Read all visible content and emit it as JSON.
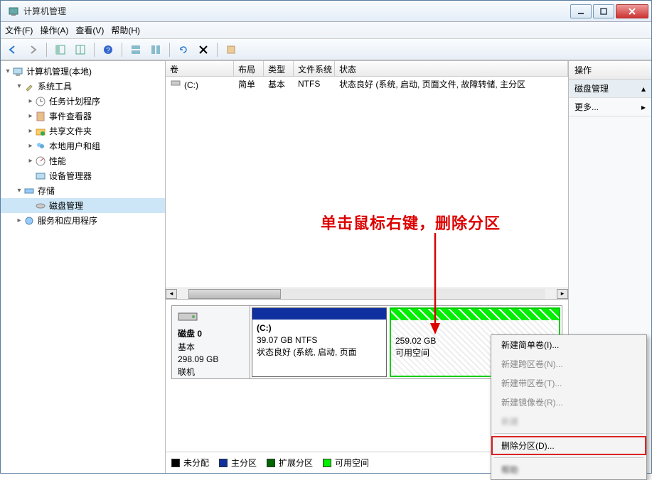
{
  "window": {
    "title": "计算机管理"
  },
  "menu": {
    "file": "文件(F)",
    "action": "操作(A)",
    "view": "查看(V)",
    "help": "帮助(H)"
  },
  "tree": {
    "root": "计算机管理(本地)",
    "system_tools": "系统工具",
    "task_scheduler": "任务计划程序",
    "event_viewer": "事件查看器",
    "shared_folders": "共享文件夹",
    "local_users": "本地用户和组",
    "performance": "性能",
    "device_manager": "设备管理器",
    "storage": "存储",
    "disk_management": "磁盘管理",
    "services_apps": "服务和应用程序"
  },
  "volume_table": {
    "headers": {
      "volume": "卷",
      "layout": "布局",
      "type": "类型",
      "fs": "文件系统",
      "status": "状态"
    },
    "row": {
      "volume": "(C:)",
      "layout": "简单",
      "type": "基本",
      "fs": "NTFS",
      "status": "状态良好 (系统, 启动, 页面文件, 故障转储, 主分区"
    }
  },
  "disk": {
    "label": "磁盘 0",
    "type": "基本",
    "size": "298.09 GB",
    "status": "联机",
    "partitions": {
      "c": {
        "name": "(C:)",
        "info": "39.07 GB NTFS",
        "status": "状态良好 (系统, 启动, 页面"
      },
      "free": {
        "size": "259.02 GB",
        "label": "可用空间"
      }
    }
  },
  "legend": {
    "unallocated": "未分配",
    "primary": "主分区",
    "extended": "扩展分区",
    "free": "可用空间"
  },
  "actions": {
    "header": "操作",
    "disk_mgmt": "磁盘管理",
    "more": "更多..."
  },
  "context_menu": {
    "new_simple": "新建简单卷(I)...",
    "new_span": "新建跨区卷(N)...",
    "new_stripe": "新建带区卷(T)...",
    "new_mirror": "新建镜像卷(R)...",
    "new_blur": "新建",
    "delete_partition": "删除分区(D)...",
    "help": "帮助"
  },
  "annotation": "单击鼠标右键，删除分区"
}
